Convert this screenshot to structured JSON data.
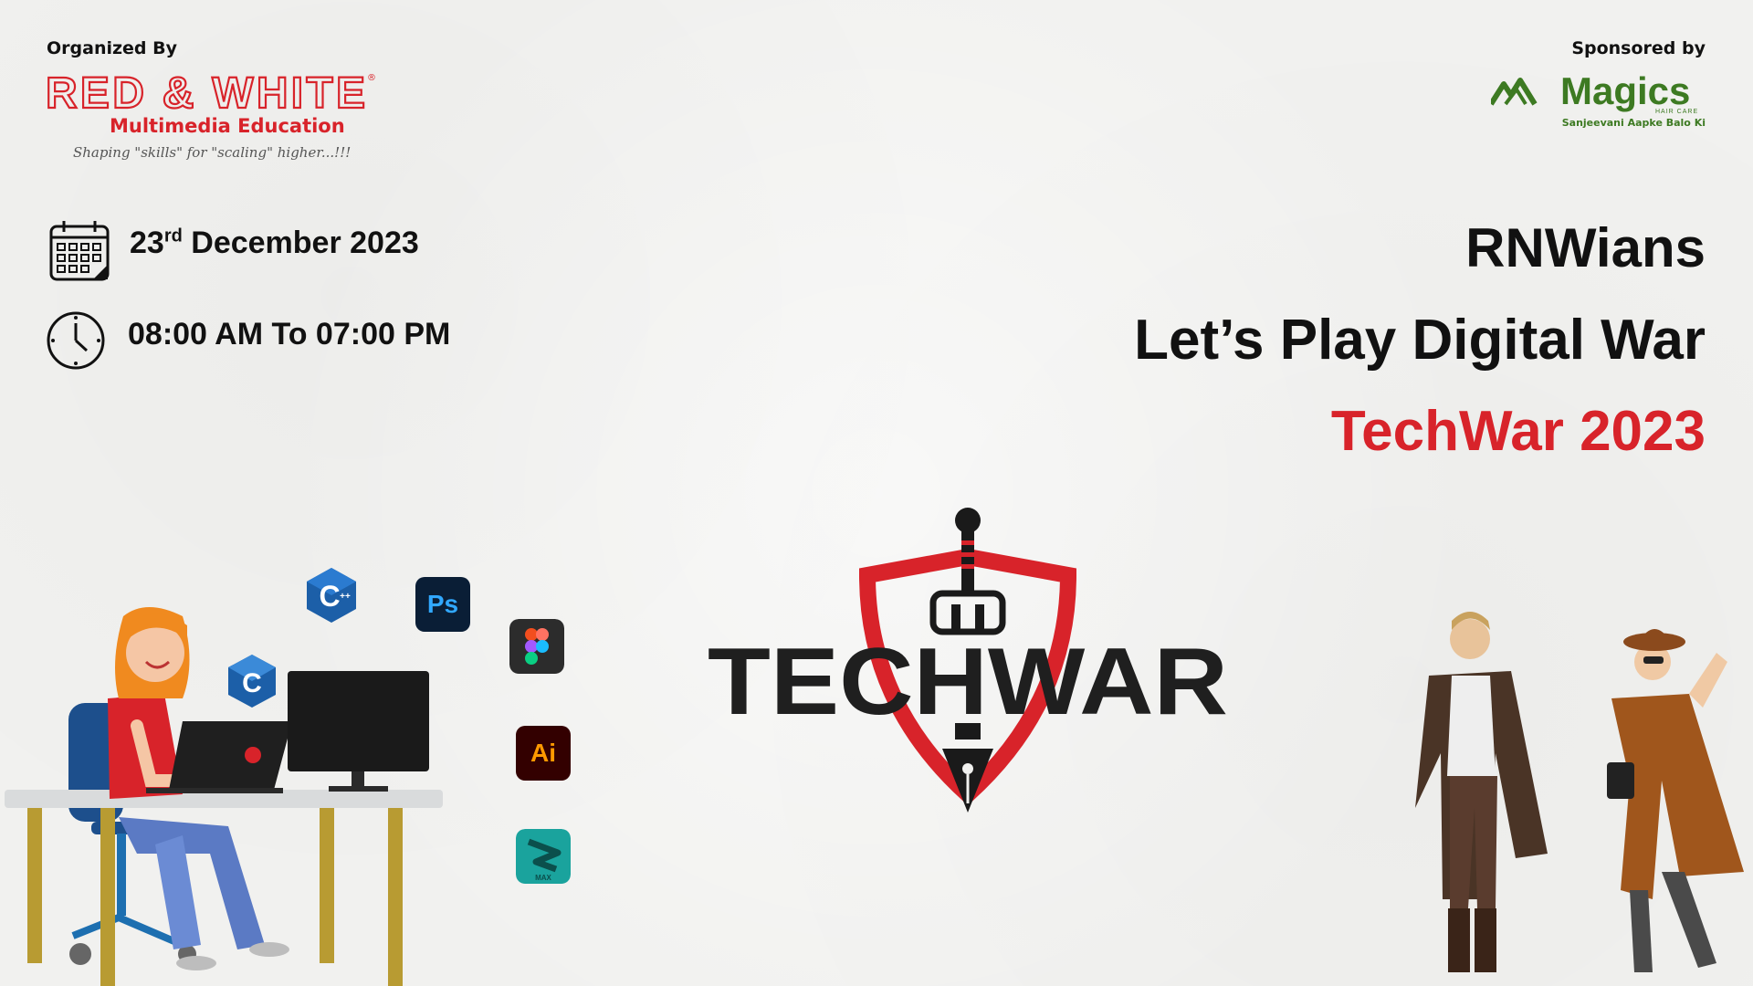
{
  "organizer": {
    "label": "Organized By",
    "brand": "RED & WHITE",
    "subtitle": "Multimedia Education",
    "tagline": "Shaping \"skills\" for \"scaling\" higher...!!!"
  },
  "sponsor": {
    "label": "Sponsored by",
    "brand": "Magics",
    "brand_small": "HAIR CARE",
    "tagline": "Sanjeevani Aapke Balo Ki"
  },
  "event": {
    "date_day": "23",
    "date_suffix": "rd",
    "date_rest": " December 2023",
    "time": "08:00 AM To 07:00 PM"
  },
  "headline": {
    "line1": "RNWians",
    "line2": "Let’s Play Digital War",
    "line3": "TechWar 2023"
  },
  "logo": {
    "text": "TECHWAR"
  },
  "icons": {
    "calendar": "calendar-icon",
    "clock": "clock-icon",
    "apps": [
      "cpp-icon",
      "c-icon",
      "photoshop-icon",
      "figma-icon",
      "illustrator-icon",
      "3dsmax-icon"
    ],
    "photoshop_text": "Ps",
    "illustrator_text": "Ai",
    "max_text": "MAX"
  },
  "colors": {
    "accent_red": "#d8232a",
    "sponsor_green": "#3d7a22",
    "text_dark": "#111111",
    "background": "#f1f1ef"
  }
}
